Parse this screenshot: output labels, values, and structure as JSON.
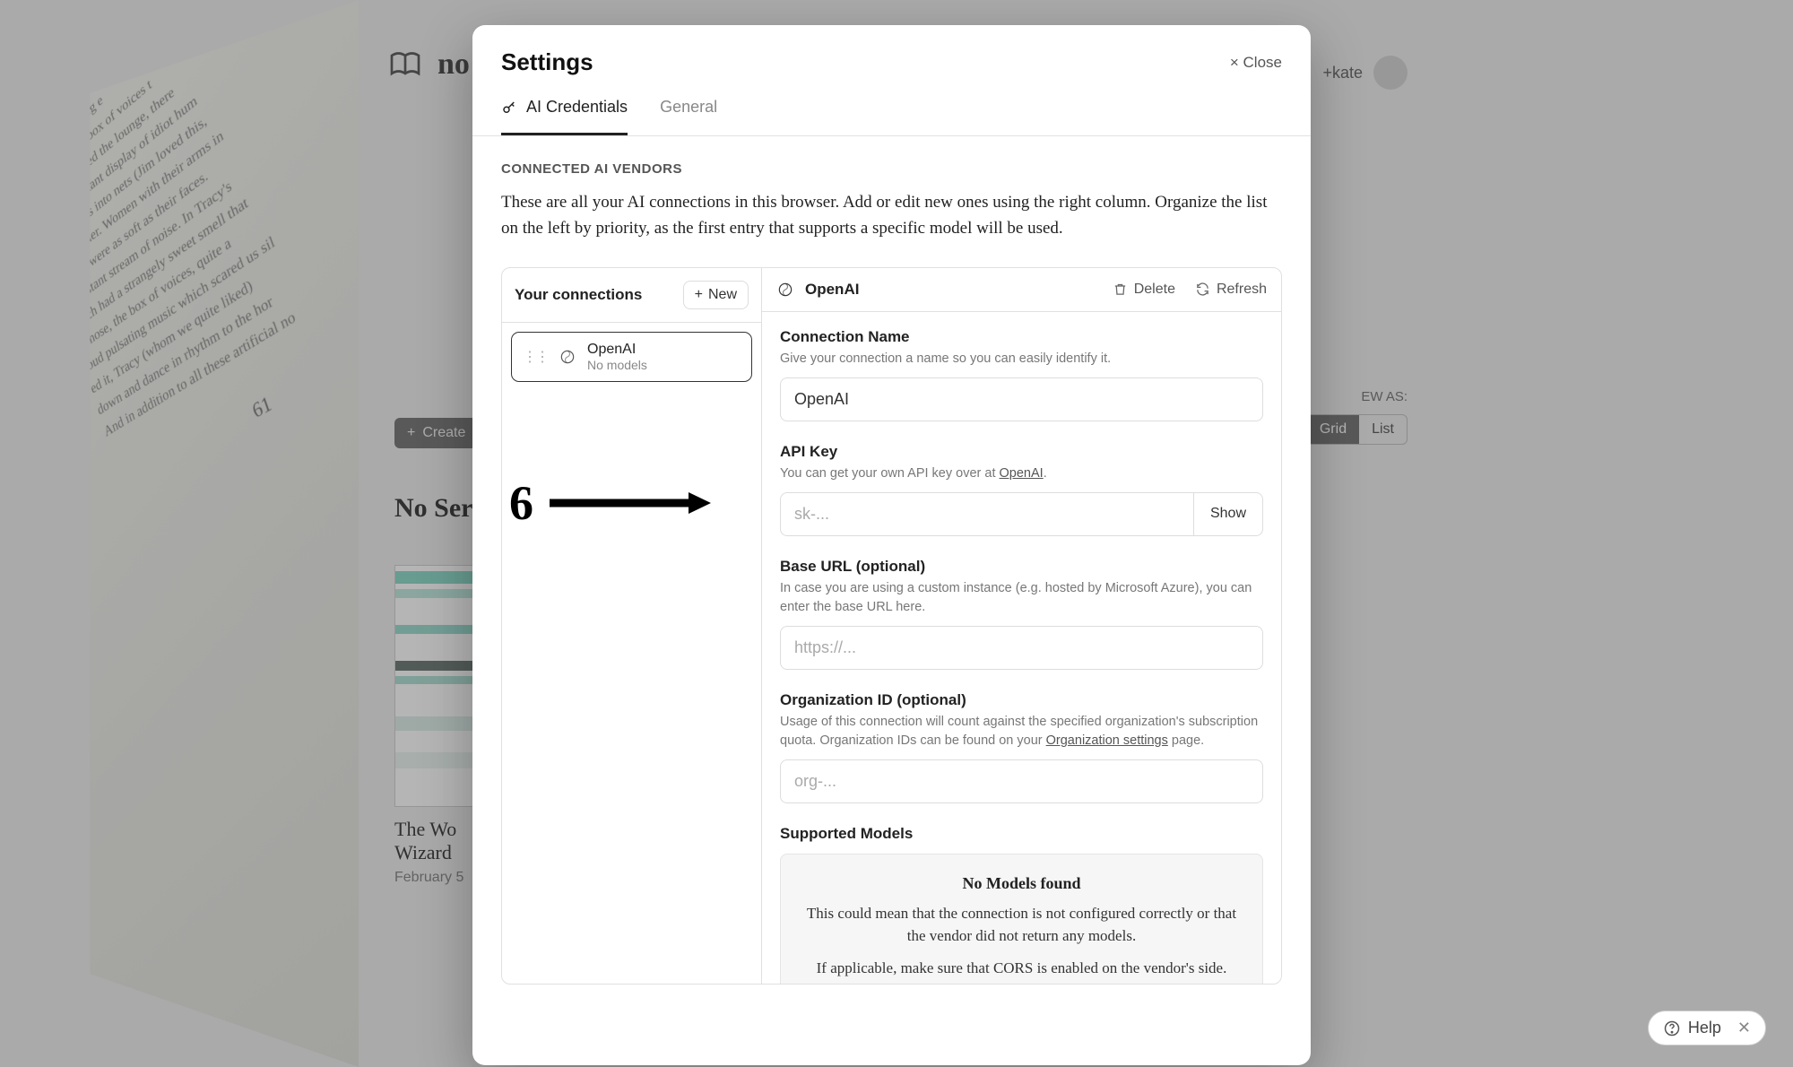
{
  "app": {
    "name": "no"
  },
  "user": {
    "name": "+kate"
  },
  "bg": {
    "create": "Create",
    "viewAsLabel": "EW AS:",
    "grid": "Grid",
    "list": "List",
    "heading": "No Seri",
    "bookTitle": "The Wo\nWizard ",
    "bookDate": "February 5",
    "pagenum": "61",
    "prose": "not going on.\nched on a whirling e\nhey played the box of voices t\noom they called the lounge, there\nwing a constant display of idiot hum\nicking balls into nets (Jim loved this,\ns of murder. Women with their arms in\ney said were as soft as their faces.\na constant stream of noise. In Tracy's\nwhich had a strangely sweet smell that\nur nose, the box of voices, quite a\nloud pulsating music which scared us sil\ned it, Tracy (whom we quite liked)\ndown and dance in rhythm to the hor\nAnd in addition to all these artificial no"
  },
  "help": {
    "label": "Help"
  },
  "modal": {
    "title": "Settings",
    "close": "Close",
    "tabs": {
      "aiCredentials": "AI Credentials",
      "general": "General"
    },
    "section": {
      "label": "CONNECTED AI VENDORS",
      "desc": "These are all your AI connections in this browser. Add or edit new ones using the right column. Organize the list on the left by priority, as the first entry that supports a specific model will be used."
    },
    "left": {
      "title": "Your connections",
      "new": "New",
      "item": {
        "name": "OpenAI",
        "sub": "No models"
      }
    },
    "annotation": {
      "num": "6"
    },
    "right": {
      "vendor": "OpenAI",
      "delete": "Delete",
      "refresh": "Refresh",
      "connName": {
        "label": "Connection Name",
        "hint": "Give your connection a name so you can easily identify it.",
        "value": "OpenAI"
      },
      "apiKey": {
        "label": "API Key",
        "hintPrefix": "You can get your own API key over at ",
        "hintLink": "OpenAI",
        "placeholder": "sk-...",
        "show": "Show"
      },
      "baseUrl": {
        "label": "Base URL (optional)",
        "hint": "In case you are using a custom instance (e.g. hosted by Microsoft Azure), you can enter the base URL here.",
        "placeholder": "https://..."
      },
      "orgId": {
        "label": "Organization ID (optional)",
        "hintPrefix": "Usage of this connection will count against the specified organization's subscription quota. Organization IDs can be found on your ",
        "hintLink": "Organization settings",
        "hintSuffix": " page.",
        "placeholder": "org-..."
      },
      "models": {
        "label": "Supported Models",
        "emptyTitle": "No Models found",
        "emptyP1": "This could mean that the connection is not configured correctly or that the vendor did not return any models.",
        "emptyP2": "If applicable, make sure that CORS is enabled on the vendor's side."
      }
    }
  }
}
